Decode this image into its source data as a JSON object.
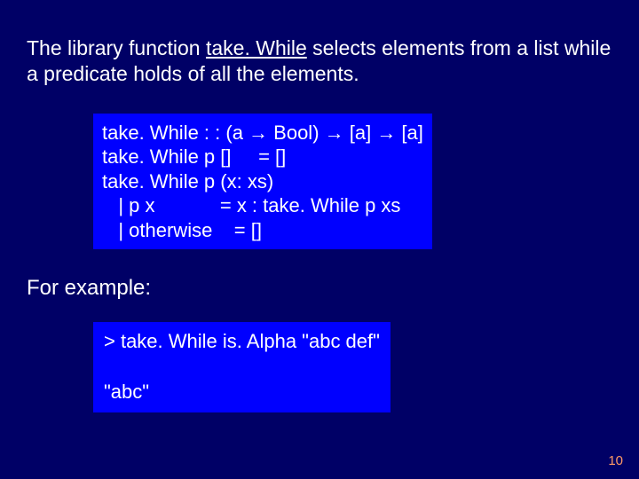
{
  "intro": {
    "pre": "The library function ",
    "underlined": "take. While",
    "post": " selects elements from a list while a predicate holds of all the elements."
  },
  "code": {
    "line1": "take. While : : (a → Bool) → [a] → [a]",
    "line2": "take. While p []     = []",
    "line3": "take. While p (x: xs)",
    "line4": "   | p x            = x : take. While p xs",
    "line5": "   | otherwise    = []"
  },
  "for_example": "For example:",
  "example": {
    "line1": "> take. While is. Alpha \"abc def\"",
    "line2": "",
    "line3": "\"abc\""
  },
  "page_number": "10"
}
